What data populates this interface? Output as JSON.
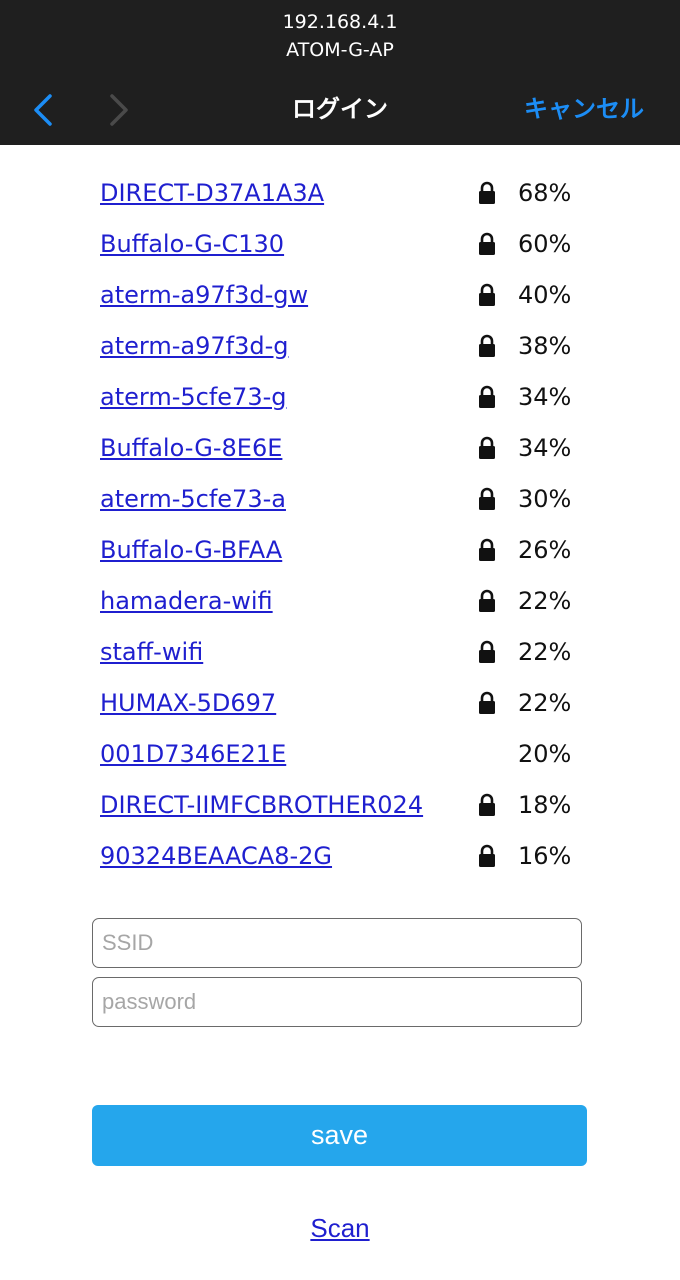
{
  "header": {
    "host": "192.168.4.1",
    "network": "ATOM-G-AP",
    "title": "ログイン",
    "cancel_label": "キャンセル"
  },
  "networks": [
    {
      "ssid": "DIRECT-D37A1A3A",
      "locked": true,
      "signal": "68%"
    },
    {
      "ssid": "Buffalo-G-C130",
      "locked": true,
      "signal": "60%"
    },
    {
      "ssid": "aterm-a97f3d-gw",
      "locked": true,
      "signal": "40%"
    },
    {
      "ssid": "aterm-a97f3d-g",
      "locked": true,
      "signal": "38%"
    },
    {
      "ssid": "aterm-5cfe73-g",
      "locked": true,
      "signal": "34%"
    },
    {
      "ssid": "Buffalo-G-8E6E",
      "locked": true,
      "signal": "34%"
    },
    {
      "ssid": "aterm-5cfe73-a",
      "locked": true,
      "signal": "30%"
    },
    {
      "ssid": "Buffalo-G-BFAA",
      "locked": true,
      "signal": "26%"
    },
    {
      "ssid": "hamadera-wifi",
      "locked": true,
      "signal": "22%"
    },
    {
      "ssid": "staff-wifi",
      "locked": true,
      "signal": "22%"
    },
    {
      "ssid": "HUMAX-5D697",
      "locked": true,
      "signal": "22%"
    },
    {
      "ssid": "001D7346E21E",
      "locked": false,
      "signal": "20%"
    },
    {
      "ssid": "DIRECT-IIMFCBROTHER024",
      "locked": true,
      "signal": "18%"
    },
    {
      "ssid": "90324BEAACA8-2G",
      "locked": true,
      "signal": "16%"
    }
  ],
  "form": {
    "ssid_placeholder": "SSID",
    "ssid_value": "",
    "password_placeholder": "password",
    "password_value": "",
    "save_label": "save",
    "scan_label": "Scan"
  },
  "colors": {
    "topbar": "#1f1f1f",
    "accent": "#1c8df5",
    "link": "#1f1fcf",
    "button": "#25a6ec"
  },
  "icons": {
    "back": "chevron-left-icon",
    "forward": "chevron-right-icon",
    "lock": "lock-icon"
  }
}
